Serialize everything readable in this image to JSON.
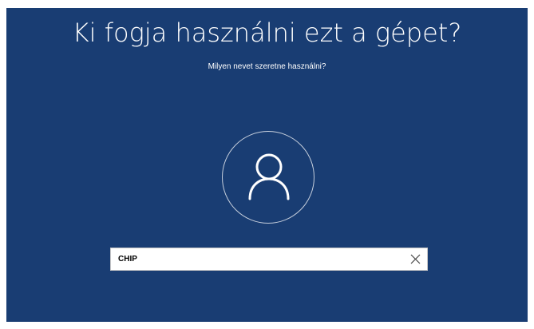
{
  "screen": {
    "title": "Ki fogja használni ezt a gépet?",
    "subtitle": "Milyen nevet szeretne használni?",
    "background_color": "#193d73"
  },
  "avatar": {
    "icon": "user-icon"
  },
  "name_input": {
    "value": "CHIP",
    "clear_icon": "close-icon"
  }
}
